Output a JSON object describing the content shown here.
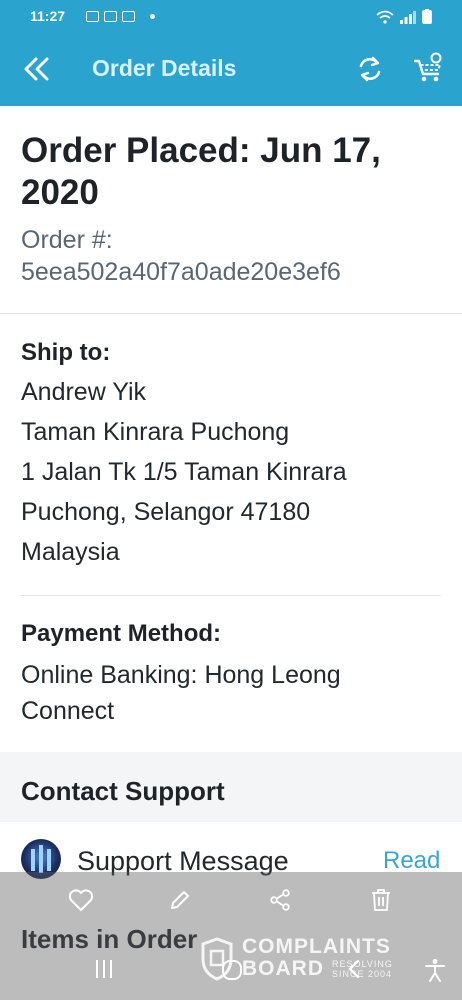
{
  "status_bar": {
    "time": "11:27",
    "icons": [
      "gallery-icon",
      "notification-icon",
      "image-icon",
      "wifi-icon",
      "signal-icon",
      "battery-icon"
    ]
  },
  "app_bar": {
    "title": "Order Details",
    "back_icon": "double-chevron-left-icon",
    "refresh_icon": "refresh-icon",
    "cart_icon": "cart-icon",
    "background": "#2aa3cf"
  },
  "order": {
    "placed_title": "Order Placed: Jun 17, 2020",
    "number_label": "Order #:",
    "number_value": "5eea502a40f7a0ade20e3ef6"
  },
  "shipping": {
    "label": "Ship to:",
    "lines": [
      "Andrew Yik",
      "Taman Kinrara Puchong",
      "1 Jalan Tk 1/5 Taman Kinrara",
      "Puchong, Selangor 47180",
      "Malaysia"
    ]
  },
  "payment": {
    "label": "Payment Method:",
    "value_line1": "Online Banking: Hong Leong",
    "value_line2": "Connect"
  },
  "contact": {
    "label": "Contact Support",
    "support_message": "Support Message",
    "read_label": "Read",
    "link_color": "#3aa6cf"
  },
  "items": {
    "title": "Items in Order"
  },
  "action_bar": {
    "icons": [
      "heart-icon",
      "pencil-icon",
      "share-icon",
      "trash-icon"
    ]
  },
  "nav_bar": {
    "icons": [
      "recent-apps-icon",
      "home-icon",
      "back-icon",
      "accessibility-icon"
    ]
  },
  "watermark": {
    "line1": "COMPLAINTS",
    "line2": "BOARD",
    "tagline": "RESOLVING SINCE 2004"
  }
}
